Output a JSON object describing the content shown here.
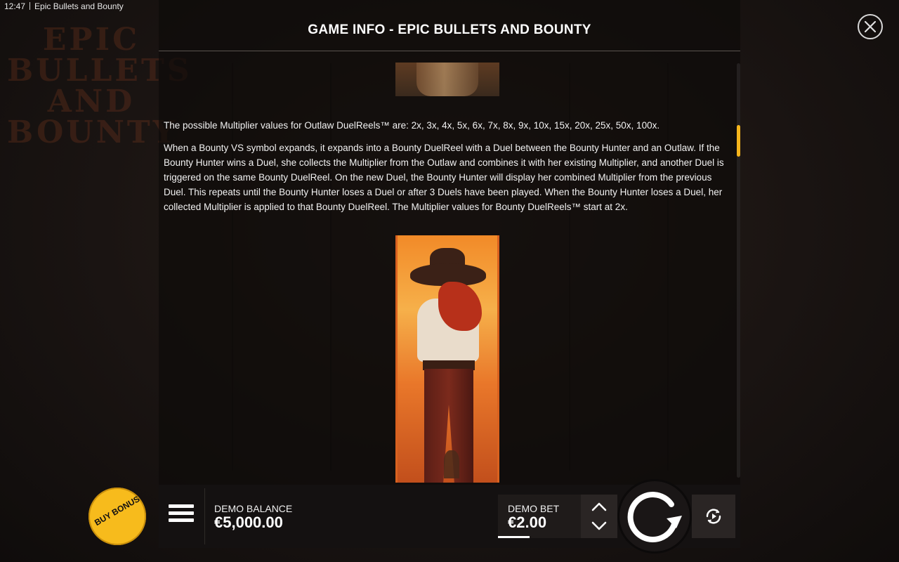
{
  "status_bar": {
    "time": "12:47",
    "app_title": "Epic Bullets and Bounty"
  },
  "background": {
    "logo_text": "EPIC BULLETS AND BOUNTY"
  },
  "info_panel": {
    "title": "GAME INFO - EPIC BULLETS AND BOUNTY",
    "paragraph_1": "The possible Multiplier values for Outlaw DuelReels™ are: 2x, 3x, 4x, 5x, 6x, 7x, 8x, 9x, 10x, 15x, 20x, 25x, 50x, 100x.",
    "paragraph_2": "When a Bounty VS symbol expands, it expands into a Bounty DuelReel with a Duel between the Bounty Hunter and an Outlaw. If the Bounty Hunter wins a Duel, she collects the Multiplier from the Outlaw and combines it with her existing Multiplier, and another Duel is triggered on the same Bounty DuelReel. On the new Duel, the Bounty Hunter will display her combined Multiplier from the previous Duel. This repeats until the Bounty Hunter loses a Duel or after 3 Duels have been played. When the Bounty Hunter loses a Duel, her collected Multiplier is applied to that Bounty DuelReel. The Multiplier values for Bounty DuelReels™ start at 2x.",
    "close_icon": "close-icon"
  },
  "bottom_bar": {
    "buy_bonus_label": "BUY BONUS",
    "balance_label": "DEMO BALANCE",
    "balance_value": "€5,000.00",
    "bet_label": "DEMO BET",
    "bet_value": "€2.00",
    "icons": [
      "menu-icon",
      "chevron-up-icon",
      "chevron-down-icon",
      "spin-icon",
      "autoplay-icon"
    ]
  },
  "colors": {
    "accent": "#f7bb1c",
    "panel_bg": "#0e0b0a",
    "bar_bg": "#141111"
  }
}
